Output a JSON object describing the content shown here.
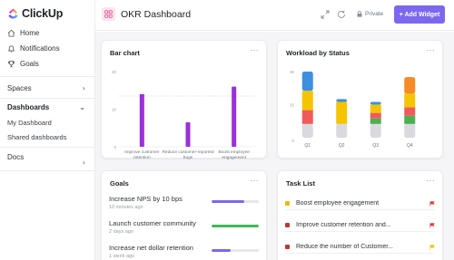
{
  "app": {
    "name": "ClickUp"
  },
  "sidebar": {
    "items": [
      {
        "label": "Home",
        "icon": "home-icon"
      },
      {
        "label": "Notifications",
        "icon": "bell-icon"
      },
      {
        "label": "Goals",
        "icon": "trophy-icon"
      }
    ],
    "spaces_label": "Spaces",
    "dashboards_label": "Dashboards",
    "dashboards_sub": [
      "My Dashboard",
      "Shared dashboards"
    ],
    "docs_label": "Docs"
  },
  "header": {
    "title": "OKR Dashboard",
    "private_label": "Private",
    "add_widget_label": "+ Add Widget"
  },
  "widgets": {
    "bar_chart": {
      "title": "Bar chart",
      "menu": "···"
    },
    "workload": {
      "title": "Workload by Status",
      "menu": "···"
    },
    "goals": {
      "title": "Goals",
      "menu": "···",
      "items": [
        {
          "name": "Increase NPS by 10 bps",
          "time": "10 minutes ago",
          "progress": 0.7,
          "color": "#7b68ee"
        },
        {
          "name": "Launch customer community",
          "time": "2 days ago",
          "progress": 1.0,
          "color": "#3cba54"
        },
        {
          "name": "Increase net dollar retention",
          "time": "1 week ago",
          "progress": 0.4,
          "color": "#7b68ee"
        }
      ]
    },
    "tasks": {
      "title": "Task List",
      "menu": "···",
      "items": [
        {
          "name": "Boost employee engagement",
          "status_color": "#f5b400",
          "flag_color": "#e03e3e"
        },
        {
          "name": "Improve customer retention and...",
          "status_color": "#b93a32",
          "flag_color": "#e03e3e"
        },
        {
          "name": "Reduce the number of Customer...",
          "status_color": "#b93a32",
          "flag_color": "#f5c400"
        }
      ]
    }
  },
  "chart_data": [
    {
      "type": "bar",
      "title": "Bar chart",
      "categories": [
        "Improve customer retention",
        "Reduce customer-reported bugs",
        "Boost employee engagement"
      ],
      "values": [
        14,
        6.5,
        16
      ],
      "yticks": [
        "0",
        "10",
        "20"
      ],
      "ylim": [
        0,
        20
      ],
      "color": "#9b30d9",
      "target_line": true
    },
    {
      "type": "bar",
      "title": "Workload by Status",
      "stacked": true,
      "categories": [
        "Q1",
        "Q2",
        "Q3",
        "Q4"
      ],
      "yticks": [
        "0",
        "15",
        "30"
      ],
      "series": [
        {
          "color": "#d9d9de",
          "values": [
            5,
            5,
            5,
            5
          ]
        },
        {
          "color": "#4caf50",
          "values": [
            0,
            0,
            2,
            3
          ]
        },
        {
          "color": "#ef5b5b",
          "values": [
            5,
            0,
            2,
            3
          ]
        },
        {
          "color": "#f5c400",
          "values": [
            7,
            8,
            3,
            5
          ]
        },
        {
          "color": "#3f8fe0",
          "values": [
            7,
            1,
            1,
            0
          ]
        },
        {
          "color": "#f58b25",
          "values": [
            0,
            0,
            0,
            6
          ]
        }
      ]
    }
  ]
}
